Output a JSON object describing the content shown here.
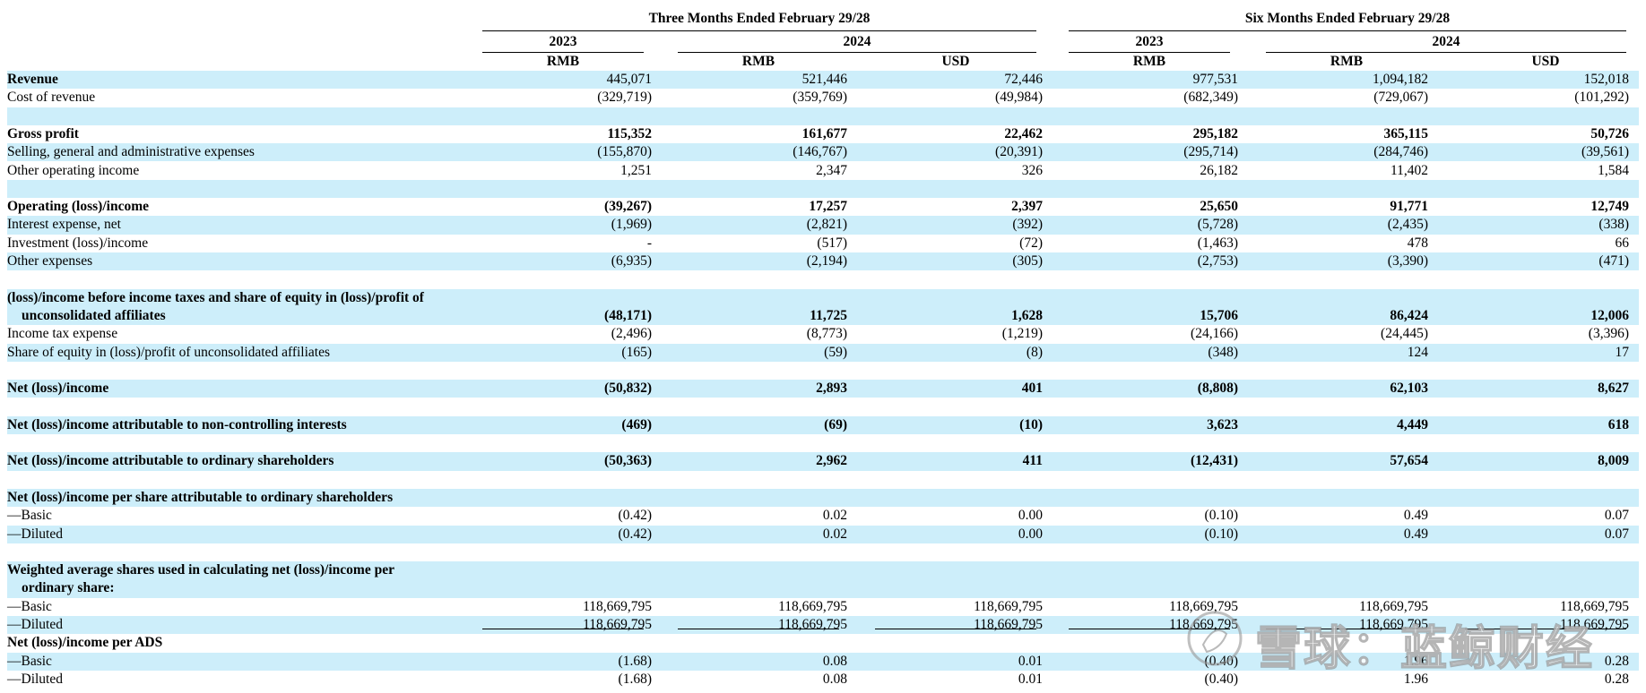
{
  "header": {
    "group_three": "Three Months Ended February 29/28",
    "group_six": "Six Months Ended February 29/28",
    "year_a": "2023",
    "year_b": "2024",
    "currency_rmb": "RMB",
    "currency_usd": "USD"
  },
  "rows": [
    {
      "label": "Revenue",
      "values": [
        "445,071",
        "521,446",
        "72,446",
        "977,531",
        "1,094,182",
        "152,018"
      ],
      "bold_label": true,
      "bold_values": false,
      "shade": true
    },
    {
      "label": "Cost of revenue",
      "values": [
        "(329,719)",
        "(359,769)",
        "(49,984)",
        "(682,349)",
        "(729,067)",
        "(101,292)"
      ],
      "shade": false
    },
    {
      "label": "",
      "values": [],
      "shade": true
    },
    {
      "label": "Gross profit",
      "values": [
        "115,352",
        "161,677",
        "22,462",
        "295,182",
        "365,115",
        "50,726"
      ],
      "bold_label": true,
      "bold_values": true,
      "shade": false
    },
    {
      "label": "Selling, general and administrative expenses",
      "values": [
        "(155,870)",
        "(146,767)",
        "(20,391)",
        "(295,714)",
        "(284,746)",
        "(39,561)"
      ],
      "shade": true
    },
    {
      "label": "Other operating income",
      "values": [
        "1,251",
        "2,347",
        "326",
        "26,182",
        "11,402",
        "1,584"
      ],
      "shade": false
    },
    {
      "label": "",
      "values": [],
      "shade": true
    },
    {
      "label": "Operating (loss)/income",
      "values": [
        "(39,267)",
        "17,257",
        "2,397",
        "25,650",
        "91,771",
        "12,749"
      ],
      "bold_label": true,
      "bold_values": true,
      "shade": false
    },
    {
      "label": "Interest expense, net",
      "values": [
        "(1,969)",
        "(2,821)",
        "(392)",
        "(5,728)",
        "(2,435)",
        "(338)"
      ],
      "shade": true
    },
    {
      "label": "Investment (loss)/income",
      "values": [
        "-",
        "(517)",
        "(72)",
        "(1,463)",
        "478",
        "66"
      ],
      "shade": false
    },
    {
      "label": "Other expenses",
      "values": [
        "(6,935)",
        "(2,194)",
        "(305)",
        "(2,753)",
        "(3,390)",
        "(471)"
      ],
      "shade": true
    },
    {
      "label": "",
      "values": [],
      "shade": false
    },
    {
      "label": "(loss)/income before income taxes and share of equity in (loss)/profit of",
      "values": [],
      "bold_label": true,
      "shade": true
    },
    {
      "label": "unconsolidated affiliates",
      "values": [
        "(48,171)",
        "11,725",
        "1,628",
        "15,706",
        "86,424",
        "12,006"
      ],
      "bold_label": true,
      "bold_values": true,
      "indent": true,
      "shade": true
    },
    {
      "label": "Income tax expense",
      "values": [
        "(2,496)",
        "(8,773)",
        "(1,219)",
        "(24,166)",
        "(24,445)",
        "(3,396)"
      ],
      "shade": false
    },
    {
      "label": "Share of equity in (loss)/profit of unconsolidated affiliates",
      "values": [
        "(165)",
        "(59)",
        "(8)",
        "(348)",
        "124",
        "17"
      ],
      "shade": true
    },
    {
      "label": "",
      "values": [],
      "shade": false
    },
    {
      "label": "Net (loss)/income",
      "values": [
        "(50,832)",
        "2,893",
        "401",
        "(8,808)",
        "62,103",
        "8,627"
      ],
      "bold_label": true,
      "bold_values": true,
      "shade": true
    },
    {
      "label": "",
      "values": [],
      "shade": false
    },
    {
      "label": "Net (loss)/income attributable to non-controlling interests",
      "values": [
        "(469)",
        "(69)",
        "(10)",
        "3,623",
        "4,449",
        "618"
      ],
      "bold_label": true,
      "bold_values": true,
      "shade": true
    },
    {
      "label": "",
      "values": [],
      "shade": false
    },
    {
      "label": "Net (loss)/income attributable to ordinary shareholders",
      "values": [
        "(50,363)",
        "2,962",
        "411",
        "(12,431)",
        "57,654",
        "8,009"
      ],
      "bold_label": true,
      "bold_values": true,
      "shade": true
    },
    {
      "label": "",
      "values": [],
      "shade": false
    },
    {
      "label": "Net (loss)/income per share attributable to ordinary shareholders",
      "values": [],
      "bold_label": true,
      "shade": true
    },
    {
      "label": "—Basic",
      "values": [
        "(0.42)",
        "0.02",
        "0.00",
        "(0.10)",
        "0.49",
        "0.07"
      ],
      "shade": false
    },
    {
      "label": "—Diluted",
      "values": [
        "(0.42)",
        "0.02",
        "0.00",
        "(0.10)",
        "0.49",
        "0.07"
      ],
      "shade": true
    },
    {
      "label": "",
      "values": [],
      "shade": false
    },
    {
      "label": "Weighted average shares used in calculating net (loss)/income per",
      "values": [],
      "bold_label": true,
      "shade": true
    },
    {
      "label": "ordinary share:",
      "values": [],
      "bold_label": true,
      "indent": true,
      "shade": true
    },
    {
      "label": "—Basic",
      "values": [
        "118,669,795",
        "118,669,795",
        "118,669,795",
        "118,669,795",
        "118,669,795",
        "118,669,795"
      ],
      "shade": false
    },
    {
      "label": "—Diluted",
      "values": [
        "118,669,795",
        "118,669,795",
        "118,669,795",
        "118,669,795",
        "118,669,795",
        "118,669,795"
      ],
      "shade": true
    },
    {
      "label": "Net (loss)/income per ADS",
      "values": [],
      "bold_label": true,
      "shade": false
    },
    {
      "label": "—Basic",
      "values": [
        "(1.68)",
        "0.08",
        "0.01",
        "(0.40)",
        "1.96",
        "0.28"
      ],
      "shade": true
    },
    {
      "label": "—Diluted",
      "values": [
        "(1.68)",
        "0.08",
        "0.01",
        "(0.40)",
        "1.96",
        "0.28"
      ],
      "shade": false
    }
  ],
  "watermark": {
    "text": "雪球：蓝鲸财经",
    "icon": "snowball-logo-icon"
  },
  "colors": {
    "band": "#cdeefa",
    "text": "#000000"
  }
}
